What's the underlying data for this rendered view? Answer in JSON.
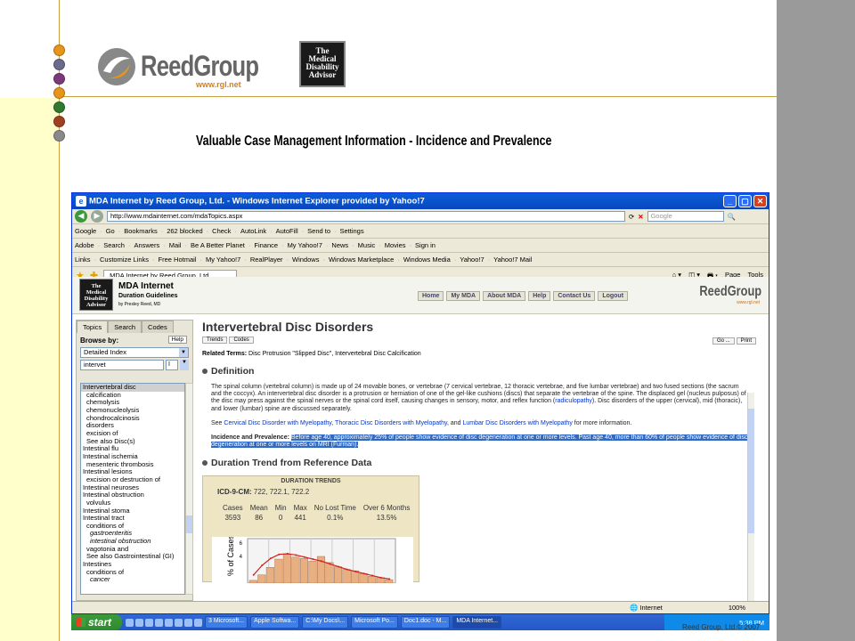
{
  "slide": {
    "title": "Valuable Case Management Information - Incidence and Prevalence",
    "logo_name": "ReedGroup",
    "logo_url": "www.rgl.net",
    "mda_logo_lines": [
      "The",
      "Medical",
      "Disability",
      "Advisor"
    ],
    "footer": "Reed Group, Ltd.© 2007",
    "bullet_colors": [
      "#e6941a",
      "#6a6a8a",
      "#7a3a7a",
      "#e6941a",
      "#2f7a2f",
      "#a04020",
      "#8a8a8a"
    ]
  },
  "browser": {
    "title": "MDA Internet by Reed Group, Ltd. - Windows Internet Explorer provided by Yahoo!7",
    "address": "http://www.mdainternet.com/mdaTopics.aspx",
    "search_placeholder": "Google",
    "google_bar": [
      "Google",
      "Go",
      "Bookmarks",
      "262 blocked",
      "Check",
      "AutoLink",
      "AutoFill",
      "Send to",
      "Settings"
    ],
    "yahoo_bar": [
      "Adobe",
      "Search",
      "Answers",
      "Mail",
      "Be A Better Planet",
      "Finance",
      "My Yahoo!7",
      "News",
      "Music",
      "Movies",
      "Sign in"
    ],
    "links": [
      "Links",
      "Customize Links",
      "Free Hotmail",
      "My Yahoo!7",
      "RealPlayer",
      "Windows",
      "Windows Marketplace",
      "Windows Media",
      "Yahoo!7",
      "Yahoo!7 Mail"
    ],
    "tab_label": "MDA Internet by Reed Group, Ltd.",
    "cmd_page": "Page",
    "cmd_tools": "Tools",
    "status_zone": "Internet",
    "status_zoom": "100%"
  },
  "site": {
    "header_title": "MDA Internet",
    "header_sub": "Duration Guidelines",
    "header_by": "by Presley Reed, MD",
    "nav": [
      "Home",
      "My MDA",
      "About MDA",
      "Help",
      "Contact Us",
      "Logout"
    ],
    "brand": "ReedGroup",
    "brand_url": "www.rgl.net"
  },
  "sidepanel": {
    "tabs": [
      "Topics",
      "Search",
      "Codes"
    ],
    "browse_label": "Browse by:",
    "help": "Help",
    "select_value": "Detailed Index",
    "search_value": "intervet",
    "search_letter": "I",
    "items": [
      {
        "t": "Intervertebral disc",
        "c": "sel"
      },
      {
        "t": "calcification",
        "c": "ind"
      },
      {
        "t": "chemolysis",
        "c": "ind"
      },
      {
        "t": "chemonucleolysis",
        "c": "ind"
      },
      {
        "t": "chondrocalcinosis",
        "c": "ind"
      },
      {
        "t": "disorders",
        "c": "ind"
      },
      {
        "t": "excision of",
        "c": "ind"
      },
      {
        "t": "See also Disc(s)",
        "c": "ind"
      },
      {
        "t": "Intestinal flu",
        "c": ""
      },
      {
        "t": "Intestinal ischemia",
        "c": ""
      },
      {
        "t": "mesenteric thrombosis",
        "c": "ind"
      },
      {
        "t": "Intestinal lesions",
        "c": ""
      },
      {
        "t": "excision or destruction of",
        "c": "ind"
      },
      {
        "t": "Intestinal neuroses",
        "c": ""
      },
      {
        "t": "Intestinal obstruction",
        "c": ""
      },
      {
        "t": "volvulus",
        "c": "ind"
      },
      {
        "t": "Intestinal stoma",
        "c": ""
      },
      {
        "t": "Intestinal tract",
        "c": ""
      },
      {
        "t": "conditions of",
        "c": "ind"
      },
      {
        "t": "gastroenteritis",
        "c": "ind2"
      },
      {
        "t": "intestinal obstruction",
        "c": "ind2"
      },
      {
        "t": "vagotonia and",
        "c": "ind"
      },
      {
        "t": "See also Gastrointestinal (GI)",
        "c": "ind"
      },
      {
        "t": "Intestines",
        "c": ""
      },
      {
        "t": "conditions of",
        "c": "ind"
      },
      {
        "t": "cancer",
        "c": "ind2"
      }
    ]
  },
  "content": {
    "title": "Intervertebral Disc Disorders",
    "btn_trends": "Trends",
    "btn_codes": "Codes",
    "btn_go": "Go ...",
    "btn_print": "Print",
    "related_label": "Related Terms:",
    "related_text": "Disc Protrusion \"Slipped Disc\", Intervertebral Disc Calcification",
    "definition_heading": "Definition",
    "definition_text_1": "The spinal column (vertebral column) is made up of 24 movable bones, or vertebrae (7 cervical vertebrae, 12 thoracic vertebrae, and five lumbar vertebrae) and two fused sections (the sacrum and the coccyx). An intervertebral disc disorder is a protrusion or herniation of one of the gel-like cushions (discs) that separate the vertebrae of the spine. The displaced gel (nucleus pulposus) of the disc may press against the spinal nerves or the spinal cord itself, causing changes in sensory, motor, and reflex function (",
    "definition_link": "radiculopathy",
    "definition_text_2": "). Disc disorders of the upper (cervical), mid (thoracic), and lower (lumbar) spine are discussed separately.",
    "see_prefix": "See",
    "see_link_1": "Cervical Disc Disorder with Myelopathy",
    "see_link_2": "Thoracic Disc Disorders with Myelopathy",
    "see_and": ", and",
    "see_link_3": "Lumbar Disc Disorders with Myelopathy",
    "see_suffix": "for more information.",
    "incidence_label": "Incidence and Prevalence:",
    "incidence_text": "Before age 40, approximately 25% of people show evidence of disc degeneration at one or more levels. Past age 40, more than 60% of people show evidence of disc degeneration at one or more levels on MRI (Furman).",
    "duration_heading": "Duration Trend from Reference Data",
    "trends_title": "DURATION TRENDS",
    "icd_label": "ICD-9-CM:",
    "icd_value": "722, 722.1, 722.2",
    "table_headers": [
      "Cases",
      "Mean",
      "Min",
      "Max",
      "No Lost Time",
      "Over 6 Months"
    ],
    "table_values": [
      "3593",
      "86",
      "0",
      "441",
      "0.1%",
      "13.5%"
    ]
  },
  "chart_data": {
    "type": "bar",
    "ylabel": "% of Cases",
    "yticks": [
      "6",
      "4"
    ],
    "ylim": [
      0,
      6.5
    ],
    "values": [
      0.4,
      1.2,
      2.3,
      3.5,
      4.2,
      3.8,
      3.6,
      3.2,
      3.9,
      3.0,
      2.4,
      2.0,
      1.8,
      1.4,
      1.0,
      0.8,
      0.5
    ],
    "trend": [
      1.2,
      2.6,
      3.6,
      4.2,
      4.3,
      4.1,
      3.8,
      3.5,
      3.2,
      2.8,
      2.4,
      2.0,
      1.7,
      1.4,
      1.1,
      0.8,
      0.6
    ],
    "bar_color": "#e8b080",
    "line_color": "#d02020",
    "grid": true
  },
  "taskbar": {
    "start": "start",
    "tasks": [
      "3 Microsoft...",
      "Apple Softwa...",
      "C:\\My Docs\\...",
      "Microsoft Po...",
      "Doc1.doc - M...",
      "MDA Internet..."
    ],
    "clock": "5:38 PM"
  }
}
